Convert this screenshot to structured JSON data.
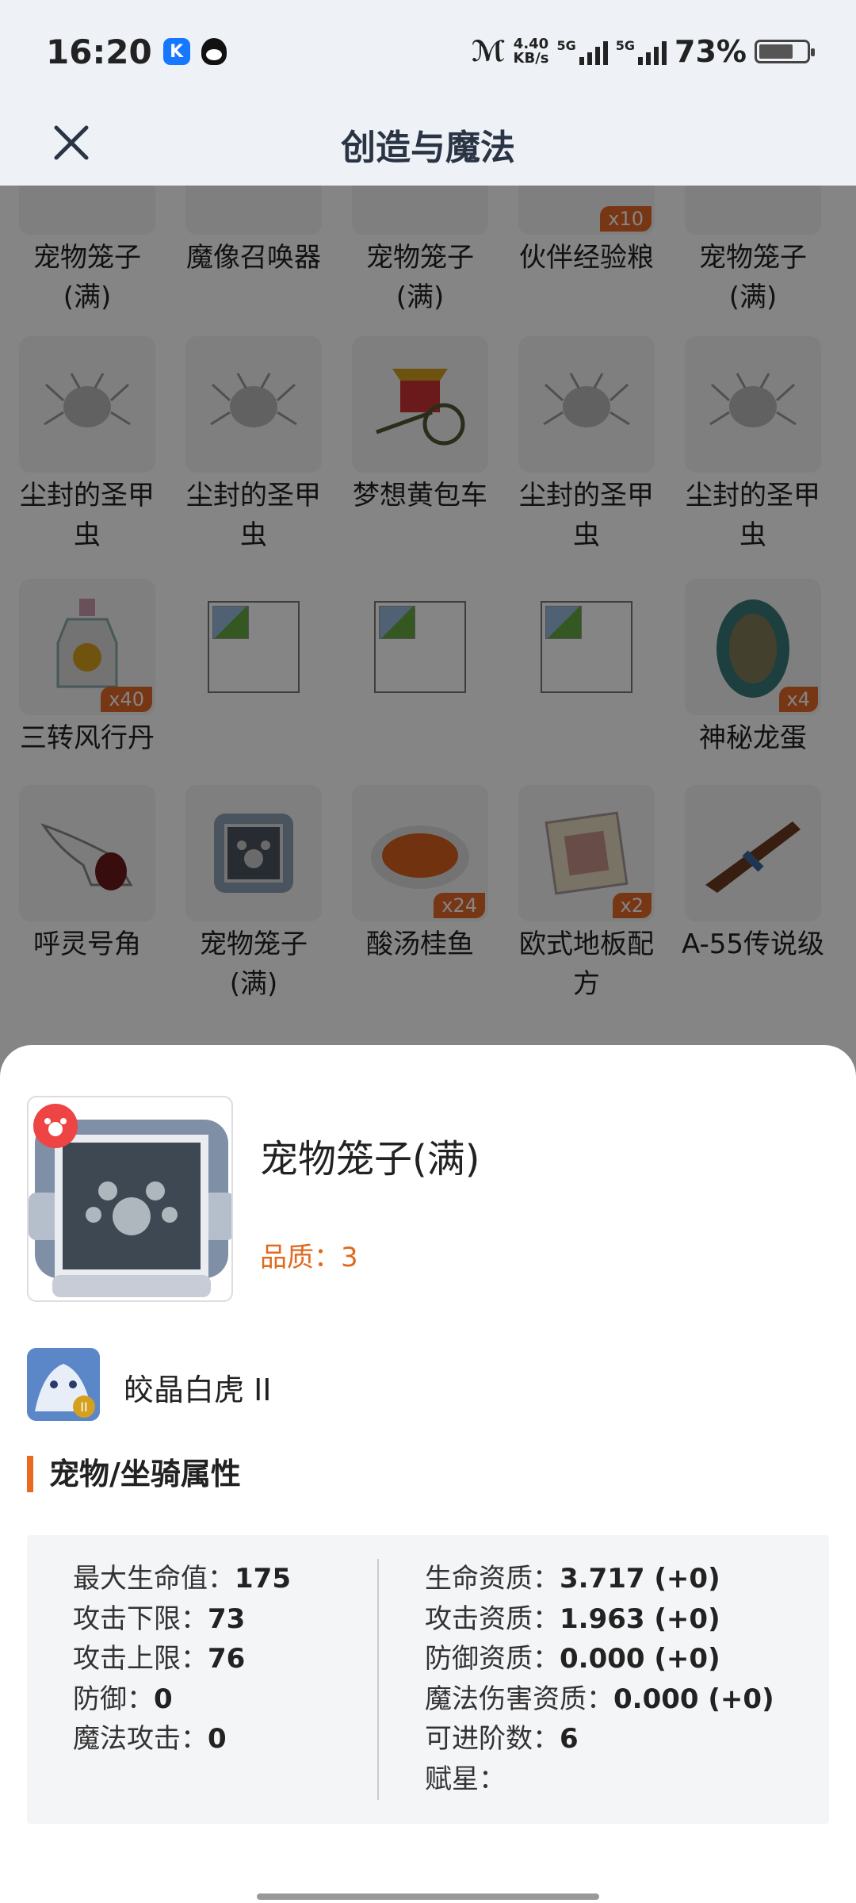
{
  "status": {
    "time": "16:20",
    "net_speed_top": "4.40",
    "net_speed_bottom": "KB/s",
    "sig1_label": "5G",
    "sig2_label": "5G",
    "battery": "73%",
    "battery_level": 0.73
  },
  "header": {
    "title": "创造与魔法"
  },
  "grid": {
    "row0": [
      {
        "name_l1": "宠物笼子",
        "name_l2": "(满)",
        "count": ""
      },
      {
        "name_l1": "魔像召唤器",
        "name_l2": "",
        "count": ""
      },
      {
        "name_l1": "宠物笼子",
        "name_l2": "(满)",
        "count": ""
      },
      {
        "name_l1": "伙伴经验粮",
        "name_l2": "",
        "count": "x10"
      },
      {
        "name_l1": "宠物笼子",
        "name_l2": "(满)",
        "count": ""
      }
    ],
    "row1": [
      {
        "name_l1": "尘封的圣甲",
        "name_l2": "虫",
        "count": ""
      },
      {
        "name_l1": "尘封的圣甲",
        "name_l2": "虫",
        "count": ""
      },
      {
        "name_l1": "梦想黄包车",
        "name_l2": "",
        "count": ""
      },
      {
        "name_l1": "尘封的圣甲",
        "name_l2": "虫",
        "count": ""
      },
      {
        "name_l1": "尘封的圣甲",
        "name_l2": "虫",
        "count": ""
      }
    ],
    "row2": [
      {
        "name_l1": "三转风行丹",
        "name_l2": "",
        "count": "x40"
      },
      {
        "name_l1": "",
        "name_l2": "",
        "count": ""
      },
      {
        "name_l1": "",
        "name_l2": "",
        "count": ""
      },
      {
        "name_l1": "",
        "name_l2": "",
        "count": ""
      },
      {
        "name_l1": "神秘龙蛋",
        "name_l2": "",
        "count": "x4"
      }
    ],
    "row3": [
      {
        "name_l1": "呼灵号角",
        "name_l2": "",
        "count": ""
      },
      {
        "name_l1": "宠物笼子",
        "name_l2": "(满)",
        "count": ""
      },
      {
        "name_l1": "酸汤桂鱼",
        "name_l2": "",
        "count": "x24"
      },
      {
        "name_l1": "欧式地板配",
        "name_l2": "方",
        "count": "x2"
      },
      {
        "name_l1": "A-55传说级",
        "name_l2": "",
        "count": ""
      }
    ]
  },
  "detail": {
    "item_name": "宠物笼子(满)",
    "quality": "品质：3",
    "pet_name": "皎晶白虎 II",
    "section_title": "宠物/坐骑属性",
    "left_attrs": [
      {
        "label": "最大生命值：",
        "value": "175"
      },
      {
        "label": "攻击下限：",
        "value": "73"
      },
      {
        "label": "攻击上限：",
        "value": "76"
      },
      {
        "label": "防御：",
        "value": "0"
      },
      {
        "label": "魔法攻击：",
        "value": "0"
      }
    ],
    "right_attrs": [
      {
        "label": "生命资质：",
        "value": "3.717 (+0)"
      },
      {
        "label": "攻击资质：",
        "value": "1.963 (+0)"
      },
      {
        "label": "防御资质：",
        "value": "0.000 (+0)"
      },
      {
        "label": "魔法伤害资质：",
        "value": "0.000 (+0)"
      },
      {
        "label": "可进阶数：",
        "value": "6"
      },
      {
        "label": "赋星：",
        "value": ""
      }
    ]
  }
}
